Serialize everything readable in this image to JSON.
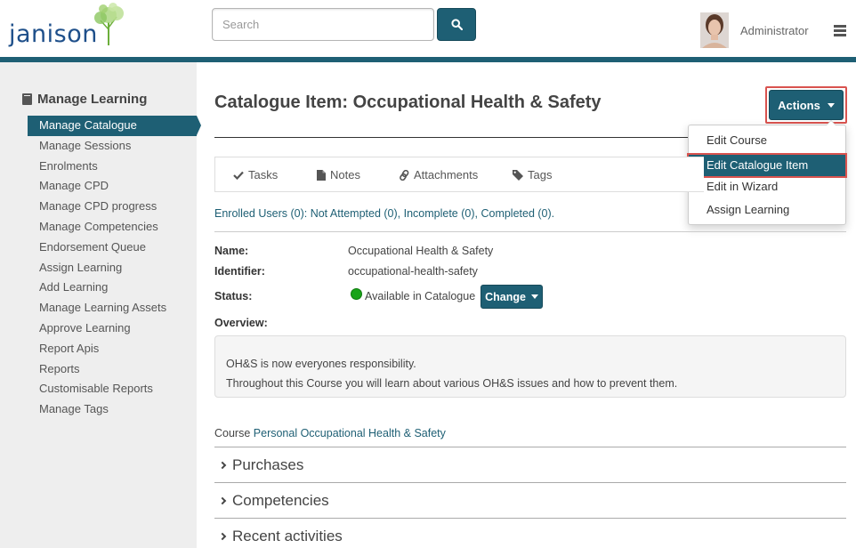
{
  "header": {
    "logo_text": "janison",
    "search_placeholder": "Search",
    "user_name": "Administrator"
  },
  "sidebar": {
    "title": "Manage Learning",
    "items": [
      "Manage Catalogue",
      "Manage Sessions",
      "Enrolments",
      "Manage CPD",
      "Manage CPD progress",
      "Manage Competencies",
      "Endorsement Queue",
      "Assign Learning",
      "Add Learning",
      "Manage Learning Assets",
      "Approve Learning",
      "Report Apis",
      "Reports",
      "Customisable Reports",
      "Manage Tags"
    ],
    "active_index": 0
  },
  "main": {
    "title": "Catalogue Item: Occupational Health & Safety",
    "actions_label": "Actions",
    "actions_menu": [
      "Edit Course",
      "Edit Catalogue Item",
      "Edit in Wizard",
      "Assign Learning"
    ],
    "tabs": [
      "Tasks",
      "Notes",
      "Attachments",
      "Tags"
    ],
    "enrolled": {
      "prefix": "Enrolled Users (0):",
      "not_attempted": "Not Attempted (0)",
      "incomplete": "Incomplete (0)",
      "completed": "Completed (0)"
    },
    "fields": {
      "name_label": "Name:",
      "name_value": "Occupational Health & Safety",
      "identifier_label": "Identifier:",
      "identifier_value": "occupational-health-safety",
      "status_label": "Status:",
      "status_value": "Available in Catalogue",
      "change_label": "Change",
      "overview_label": "Overview:"
    },
    "overview_lines": [
      "OH&S is now everyones responsibility.",
      "Throughout this Course you will learn about various OH&S issues and how to prevent them."
    ],
    "course_prefix": "Course",
    "course_link": "Personal Occupational Health & Safety",
    "sections": [
      "Purchases",
      "Competencies",
      "Recent activities"
    ]
  },
  "colors": {
    "brand": "#1e5f74",
    "highlight_border": "#d9534f",
    "status_green": "#19a319"
  }
}
